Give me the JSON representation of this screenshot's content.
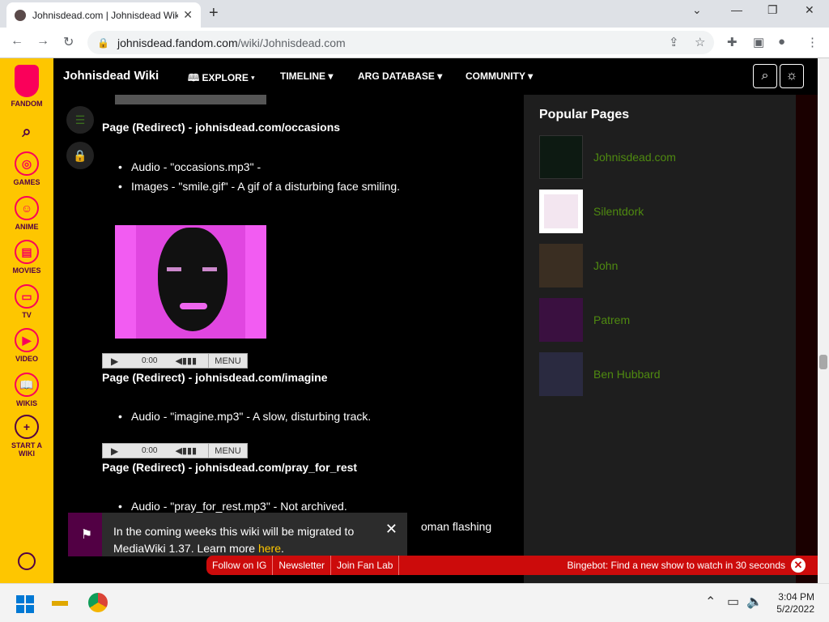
{
  "browser": {
    "tab_title": "Johnisdead.com | Johnisdead Wiki",
    "url_domain": "johnisdead.fandom.com",
    "url_path": "/wiki/Johnisdead.com"
  },
  "fandom_sidebar": {
    "logo_label": "FANDOM",
    "items": [
      {
        "label": "GAMES"
      },
      {
        "label": "ANIME"
      },
      {
        "label": "MOVIES"
      },
      {
        "label": "TV"
      },
      {
        "label": "VIDEO"
      },
      {
        "label": "WIKIS"
      },
      {
        "label": "START A WIKI"
      }
    ]
  },
  "wiki_nav": {
    "title": "Johnisdead Wiki",
    "items": [
      "EXPLORE",
      "TIMELINE",
      "ARG DATABASE",
      "COMMUNITY"
    ]
  },
  "content": {
    "h1": "Page (Redirect) - johnisdead.com/occasions",
    "b1": "Audio - \"occasions.mp3\" -",
    "b2": "Images - \"smile.gif\" - A gif of a disturbing face smiling.",
    "h2": "Page (Redirect) - johnisdead.com/imagine",
    "b3": "Audio - \"imagine.mp3\" - A slow, disturbing track.",
    "h3": "Page (Redirect) - johnisdead.com/pray_for_rest",
    "b4": "Audio - \"pray_for_rest.mp3\" - Not archived.",
    "b5_tail": "oman flashing",
    "audio_time": "0:00",
    "audio_menu": "MENU"
  },
  "rail": {
    "title": "Popular Pages",
    "pages": [
      "Johnisdead.com",
      "Silentdork",
      "John",
      "Patrem",
      "Ben Hubbard"
    ]
  },
  "banner": {
    "text": "In the coming weeks this wiki will be migrated to MediaWiki 1.37. Learn more ",
    "link": "here",
    "tail": "."
  },
  "bottombar": {
    "links": [
      "Follow on IG",
      "Newsletter",
      "Join Fan Lab"
    ],
    "bingebot": "Bingebot: Find a new show to watch in 30 seconds"
  },
  "taskbar": {
    "time": "3:04 PM",
    "date": "5/2/2022"
  },
  "colors": {
    "fandom_yellow": "#fec600",
    "link_green": "#4f8a10",
    "promo_red": "#cc0b0b"
  }
}
